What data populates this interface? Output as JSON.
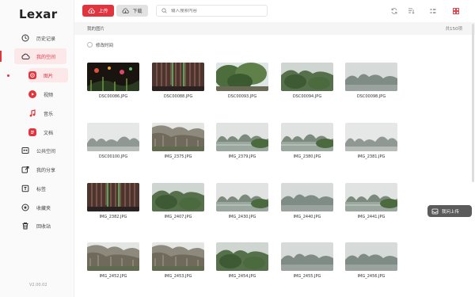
{
  "app": {
    "logo_text": "Lexar",
    "version": "V2.00.02"
  },
  "sidebar": {
    "items": [
      {
        "label": "历史记录",
        "icon": "clock-icon"
      },
      {
        "label": "我的空间",
        "icon": "cloud-icon"
      },
      {
        "label": "公共空间",
        "icon": "shared-space-icon"
      },
      {
        "label": "我的分享",
        "icon": "share-icon"
      },
      {
        "label": "标签",
        "icon": "tag-icon"
      },
      {
        "label": "收藏夹",
        "icon": "star-icon"
      },
      {
        "label": "回收站",
        "icon": "trash-icon"
      }
    ],
    "sub_items": [
      {
        "label": "图片",
        "icon": "image-icon"
      },
      {
        "label": "视频",
        "icon": "video-icon"
      },
      {
        "label": "音乐",
        "icon": "music-icon"
      },
      {
        "label": "文档",
        "icon": "document-icon"
      }
    ]
  },
  "toolbar": {
    "upload_label": "上传",
    "download_label": "下载",
    "search_placeholder": "输入搜索内容"
  },
  "breadcrumb": {
    "path": "我的图片",
    "count": "共150项"
  },
  "sort": {
    "label": "修改时间"
  },
  "photos": [
    {
      "name": "DSC00086.JPG",
      "scene": "night"
    },
    {
      "name": "DSC00088.JPG",
      "scene": "cave"
    },
    {
      "name": "DSC00093.JPG",
      "scene": "trees"
    },
    {
      "name": "DSC00094.JPG",
      "scene": "hillgreen"
    },
    {
      "name": "DSC00098.JPG",
      "scene": "mist"
    },
    {
      "name": "DSC00100.JPG",
      "scene": "foggy"
    },
    {
      "name": "IMG_2375.JPG",
      "scene": "cliff"
    },
    {
      "name": "IMG_2379.JPG",
      "scene": "riverhills"
    },
    {
      "name": "IMG_2380.JPG",
      "scene": "riverhills"
    },
    {
      "name": "IMG_2381.JPG",
      "scene": "foggy"
    },
    {
      "name": "IMG_2382.JPG",
      "scene": "cave"
    },
    {
      "name": "IMG_2407.JPG",
      "scene": "hillgreen"
    },
    {
      "name": "IMG_2430.JPG",
      "scene": "riverhills"
    },
    {
      "name": "IMG_2440.JPG",
      "scene": "mist"
    },
    {
      "name": "IMG_2441.JPG",
      "scene": "riverhills"
    },
    {
      "name": "IMG_2452.JPG",
      "scene": "cliff"
    },
    {
      "name": "IMG_2453.JPG",
      "scene": "cliff"
    },
    {
      "name": "IMG_2454.JPG",
      "scene": "hillgreen"
    },
    {
      "name": "IMG_2455.JPG",
      "scene": "mist"
    },
    {
      "name": "IMG_2456.JPG",
      "scene": "mist"
    }
  ],
  "float_upload": {
    "label": "我问上传"
  },
  "colors": {
    "accent": "#e0343f",
    "accent_light": "#fde8e9"
  }
}
